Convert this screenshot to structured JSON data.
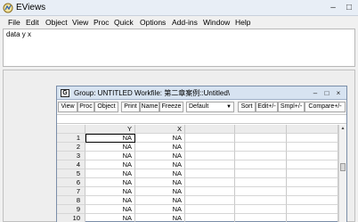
{
  "app": {
    "title": "EViews",
    "icon": "eviews-logo-icon"
  },
  "window_controls": {
    "minimize": "–",
    "maximize": "□"
  },
  "menu": [
    "File",
    "Edit",
    "Object",
    "View",
    "Proc",
    "Quick",
    "Options",
    "Add-ins",
    "Window",
    "Help"
  ],
  "command": {
    "text": "data y x"
  },
  "group_window": {
    "icon_letter": "G",
    "title": "Group: UNTITLED   Workfile: 第二章案例::Untitled\\",
    "controls": {
      "minimize": "–",
      "maximize": "□",
      "close": "×"
    },
    "toolbar": {
      "view": "View",
      "proc": "Proc",
      "object": "Object",
      "print": "Print",
      "name": "Name",
      "freeze": "Freeze",
      "format_select": "Default",
      "sort": "Sort",
      "edit": "Edit+/-",
      "smpl": "Smpl+/-",
      "compare": "Compare+/-"
    },
    "grid": {
      "columns": [
        "Y",
        "X",
        "",
        "",
        ""
      ],
      "rows": [
        {
          "label": "1",
          "y": "NA",
          "x": "NA"
        },
        {
          "label": "2",
          "y": "NA",
          "x": "NA"
        },
        {
          "label": "3",
          "y": "NA",
          "x": "NA"
        },
        {
          "label": "4",
          "y": "NA",
          "x": "NA"
        },
        {
          "label": "5",
          "y": "NA",
          "x": "NA"
        },
        {
          "label": "6",
          "y": "NA",
          "x": "NA"
        },
        {
          "label": "7",
          "y": "NA",
          "x": "NA"
        },
        {
          "label": "8",
          "y": "NA",
          "x": "NA"
        },
        {
          "label": "9",
          "y": "NA",
          "x": "NA"
        },
        {
          "label": "10",
          "y": "NA",
          "x": "NA"
        }
      ]
    }
  },
  "colors": {
    "titlebar": "#e8eef6",
    "group_titlebar": "#d7e3f1",
    "grid_header": "#ececec"
  }
}
